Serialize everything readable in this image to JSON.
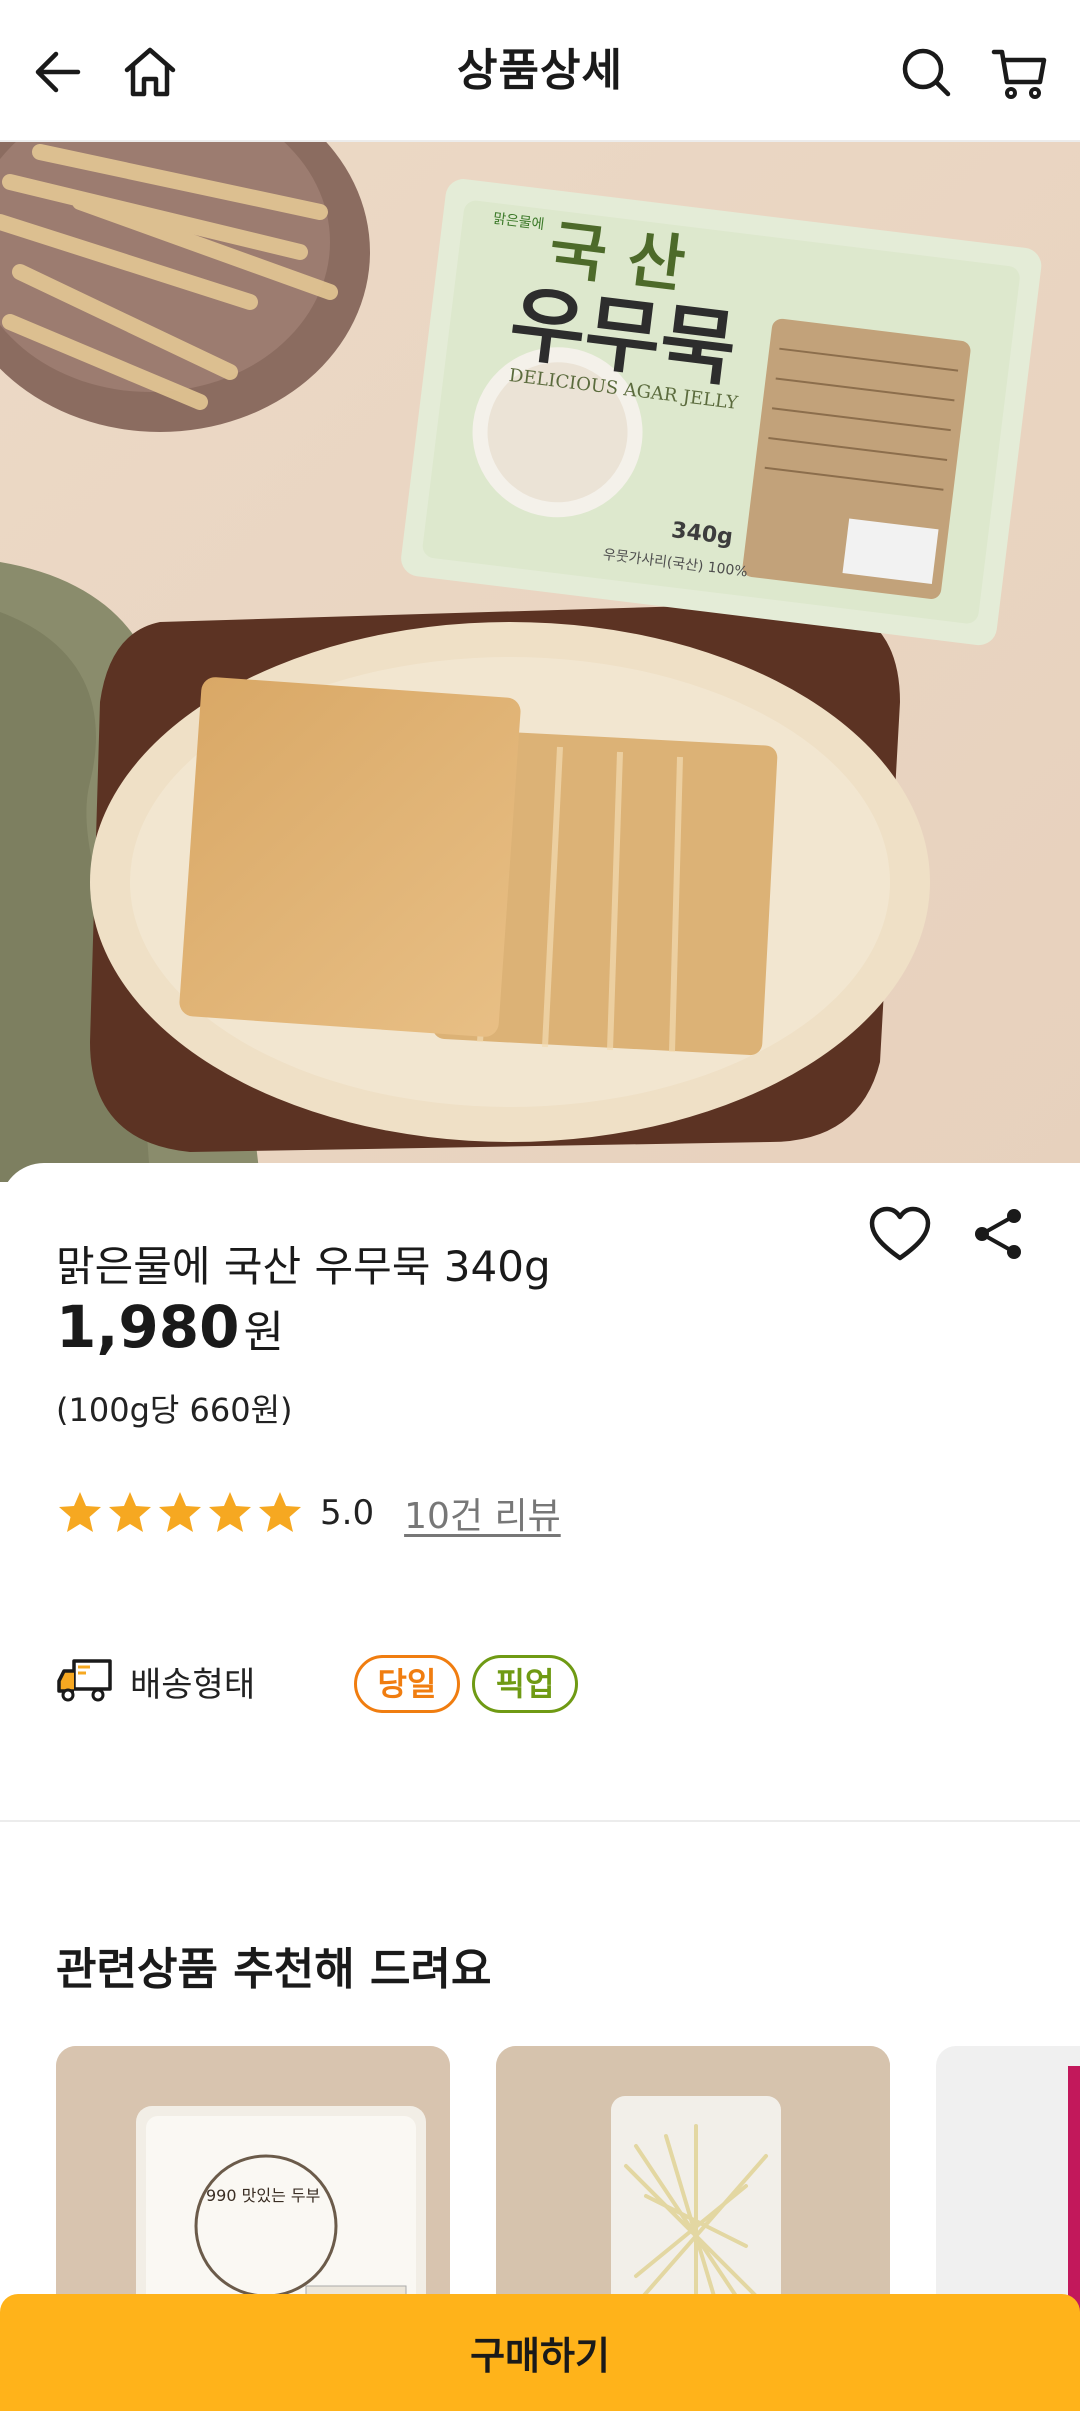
{
  "header": {
    "title": "상품상세"
  },
  "product": {
    "name": "맑은물에 국산 우무묵 340g",
    "price": "1,980",
    "currency": "원",
    "unit_price": "(100g당 660원)",
    "rating": "5.0",
    "rating_stars": 5,
    "review_link": "10건 리뷰",
    "package_text": {
      "brand_badge": "맑은물에",
      "title_line1": "국 산",
      "title_line2": "우무묵",
      "subtitle": "DELICIOUS AGAR JELLY",
      "weight": "340g",
      "origin": "우뭇가사리(국산) 100%"
    }
  },
  "delivery": {
    "label": "배송형태",
    "tags": [
      "당일",
      "픽업"
    ]
  },
  "recommend": {
    "title": "관련상품 추천해 드려요",
    "items": [
      {
        "label": "990 맛있는 두부"
      },
      {
        "label": ""
      }
    ]
  },
  "buy_button": {
    "label": "구매하기"
  },
  "colors": {
    "accent": "#ffb31a",
    "star": "#f6a821",
    "tag_sameday": "#f07d10",
    "tag_pickup": "#6f9a14"
  },
  "icons": [
    "back-arrow-icon",
    "home-icon",
    "search-icon",
    "cart-icon",
    "heart-icon",
    "share-icon",
    "star-icon",
    "delivery-truck-icon"
  ]
}
